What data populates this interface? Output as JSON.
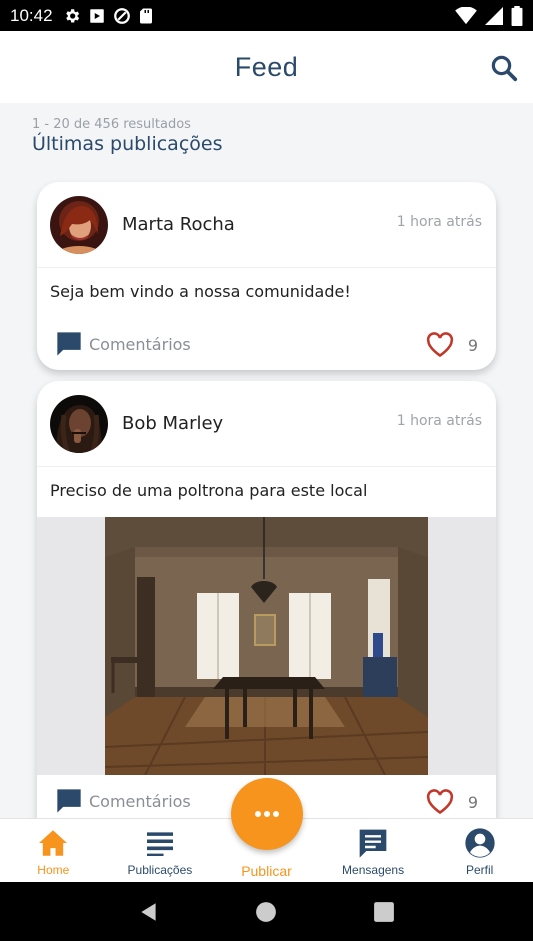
{
  "status_bar": {
    "time": "10:42"
  },
  "header": {
    "title": "Feed"
  },
  "feed": {
    "results_count": "1 - 20 de 456 resultados",
    "section_title": "Últimas publicações",
    "posts": [
      {
        "author": "Marta Rocha",
        "time": "1 hora atrás",
        "text": "Seja bem vindo a nossa comunidade!",
        "comments_label": "Comentários",
        "likes": "9",
        "has_image": false
      },
      {
        "author": "Bob Marley",
        "time": "1 hora atrás",
        "text": "Preciso de uma poltrona para este local",
        "comments_label": "Comentários",
        "likes": "9",
        "has_image": true
      }
    ]
  },
  "bottom_nav": {
    "items": [
      {
        "label": "Home",
        "icon": "home-icon",
        "active": true
      },
      {
        "label": "Publicações",
        "icon": "list-icon",
        "active": false
      },
      {
        "label": "Publicar",
        "icon": "more-dots-icon",
        "active": false
      },
      {
        "label": "Mensagens",
        "icon": "message-icon",
        "active": false
      },
      {
        "label": "Perfil",
        "icon": "account-icon",
        "active": false
      }
    ]
  },
  "colors": {
    "accent": "#f7941d",
    "primary": "#2b4a6b",
    "like": "#c0392b"
  }
}
